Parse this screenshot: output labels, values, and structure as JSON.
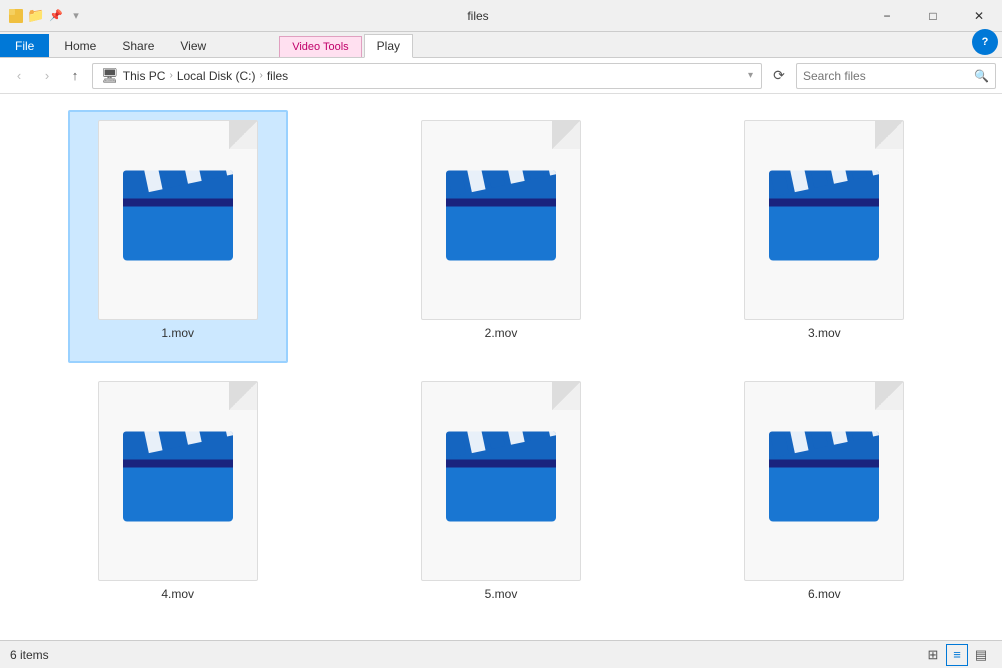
{
  "titlebar": {
    "title": "files",
    "minimize_label": "−",
    "maximize_label": "□",
    "close_label": "✕"
  },
  "ribbon": {
    "file_tab": "File",
    "tabs": [
      "Home",
      "Share",
      "View"
    ],
    "video_tools_label": "Video Tools",
    "play_tab": "Play",
    "help_label": "?"
  },
  "addressbar": {
    "back_label": "‹",
    "forward_label": "›",
    "up_label": "↑",
    "path_items": [
      "This PC",
      "Local Disk (C:)",
      "files"
    ],
    "refresh_label": "⟳",
    "search_placeholder": "Search files"
  },
  "files": [
    {
      "name": "1.mov",
      "selected": true
    },
    {
      "name": "2.mov",
      "selected": false
    },
    {
      "name": "3.mov",
      "selected": false
    },
    {
      "name": "4.mov",
      "selected": false
    },
    {
      "name": "5.mov",
      "selected": false
    },
    {
      "name": "6.mov",
      "selected": false
    }
  ],
  "statusbar": {
    "item_count": "6 items"
  },
  "colors": {
    "accent": "#0078d7",
    "clapper_top": "#1565c0",
    "clapper_body": "#1976d2",
    "stripe_light": "#ffffff",
    "stripe_dark": "#0d47a1"
  }
}
